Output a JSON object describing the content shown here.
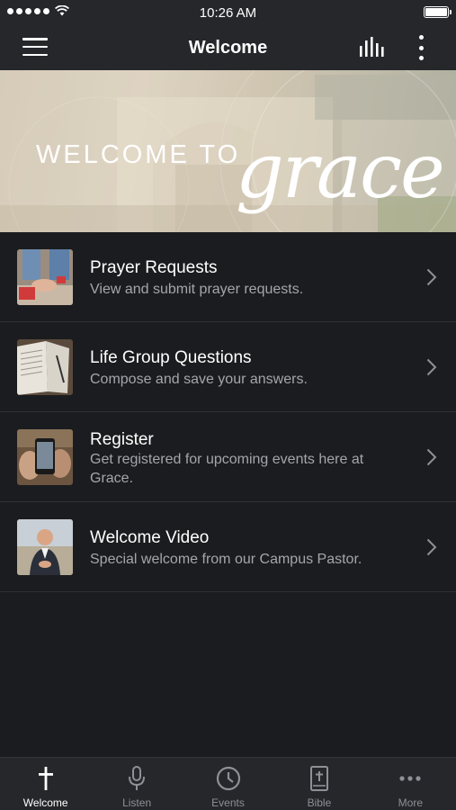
{
  "status_bar": {
    "time": "10:26 AM"
  },
  "nav": {
    "title": "Welcome"
  },
  "banner": {
    "line1": "WELCOME TO",
    "line2": "grace"
  },
  "list": [
    {
      "title": "Prayer Requests",
      "subtitle": "View and submit prayer requests."
    },
    {
      "title": "Life Group Questions",
      "subtitle": "Compose and save your answers."
    },
    {
      "title": "Register",
      "subtitle": "Get registered for upcoming events here at Grace."
    },
    {
      "title": "Welcome Video",
      "subtitle": "Special welcome from our Campus Pastor."
    }
  ],
  "tabs": [
    {
      "label": "Welcome",
      "icon": "cross-icon",
      "active": true
    },
    {
      "label": "Listen",
      "icon": "microphone-icon",
      "active": false
    },
    {
      "label": "Events",
      "icon": "clock-icon",
      "active": false
    },
    {
      "label": "Bible",
      "icon": "bible-icon",
      "active": false
    },
    {
      "label": "More",
      "icon": "more-icon",
      "active": false
    }
  ],
  "colors": {
    "background": "#1b1c1f",
    "bar": "#25272b",
    "subtitle": "#a4a6ab",
    "tab_inactive": "#8e9095"
  }
}
